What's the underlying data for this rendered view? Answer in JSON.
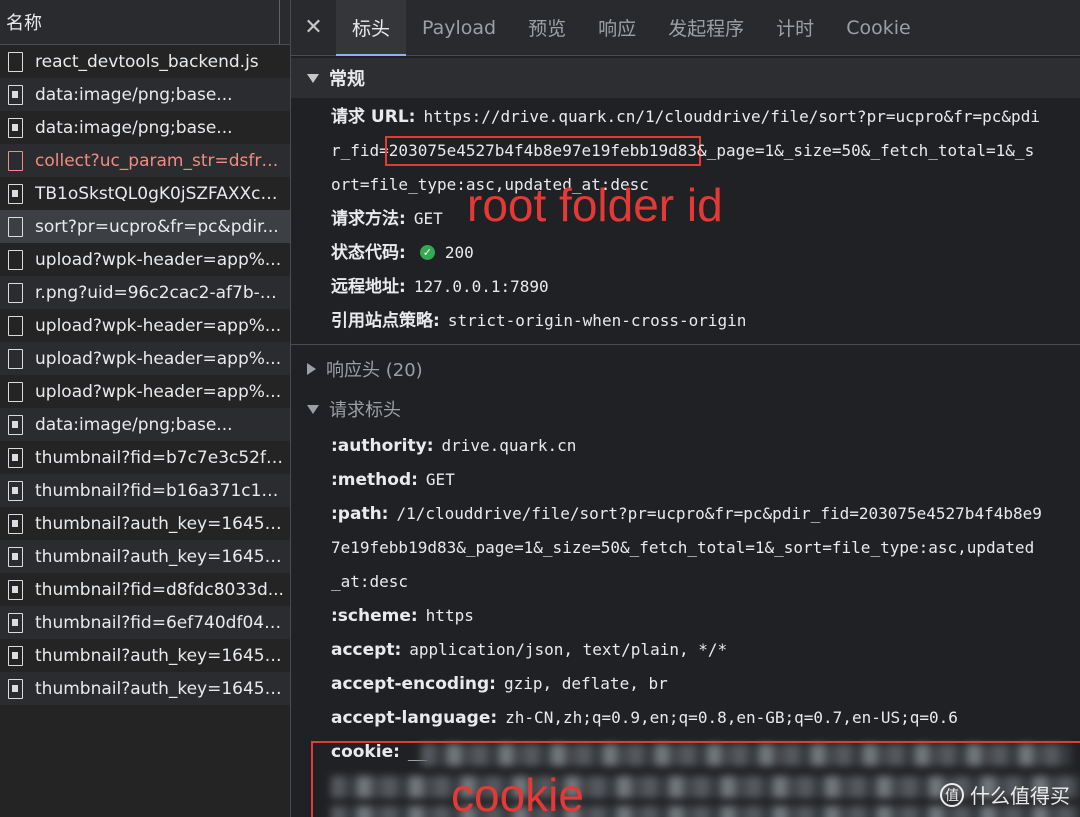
{
  "request_list": {
    "column_header": "名称",
    "items": [
      {
        "label": "react_devtools_backend.js",
        "type": "doc",
        "error": false,
        "selected": false
      },
      {
        "label": "data:image/png;base...",
        "type": "img",
        "error": false,
        "selected": false
      },
      {
        "label": "data:image/png;base...",
        "type": "img",
        "error": false,
        "selected": false
      },
      {
        "label": "collect?uc_param_str=dsfrpf...",
        "type": "doc",
        "error": true,
        "selected": false
      },
      {
        "label": "TB1oSkstQL0gK0jSZFAXXcA...",
        "type": "img",
        "error": false,
        "selected": false
      },
      {
        "label": "sort?pr=ucpro&fr=pc&pdir...",
        "type": "doc",
        "error": false,
        "selected": true
      },
      {
        "label": "upload?wpk-header=app%...",
        "type": "doc",
        "error": false,
        "selected": false
      },
      {
        "label": "r.png?uid=96c2cac2-af7b-4...",
        "type": "doc",
        "error": false,
        "selected": false
      },
      {
        "label": "upload?wpk-header=app%...",
        "type": "doc",
        "error": false,
        "selected": false
      },
      {
        "label": "upload?wpk-header=app%...",
        "type": "doc",
        "error": false,
        "selected": false
      },
      {
        "label": "upload?wpk-header=app%...",
        "type": "doc",
        "error": false,
        "selected": false
      },
      {
        "label": "data:image/png;base...",
        "type": "img",
        "error": false,
        "selected": false
      },
      {
        "label": "thumbnail?fid=b7c7e3c52f6...",
        "type": "img",
        "error": false,
        "selected": false
      },
      {
        "label": "thumbnail?fid=b16a371c10...",
        "type": "img",
        "error": false,
        "selected": false
      },
      {
        "label": "thumbnail?auth_key=16451...",
        "type": "img",
        "error": false,
        "selected": false
      },
      {
        "label": "thumbnail?auth_key=16451...",
        "type": "img",
        "error": false,
        "selected": false
      },
      {
        "label": "thumbnail?fid=d8fdc8033d...",
        "type": "img",
        "error": false,
        "selected": false
      },
      {
        "label": "thumbnail?fid=6ef740df04ff...",
        "type": "img",
        "error": false,
        "selected": false
      },
      {
        "label": "thumbnail?auth_key=16451...",
        "type": "img",
        "error": false,
        "selected": false
      },
      {
        "label": "thumbnail?auth_key=16451...",
        "type": "img",
        "error": false,
        "selected": false
      }
    ]
  },
  "tabs": {
    "close": "✕",
    "items": [
      "标头",
      "Payload",
      "预览",
      "响应",
      "发起程序",
      "计时",
      "Cookie"
    ],
    "active_index": 0
  },
  "general": {
    "title": "常规",
    "request_url_key": "请求 URL:",
    "request_url_line1": "https://drive.quark.cn/1/clouddrive/file/sort?pr=ucpro&fr=pc&pdi",
    "request_url_line2_prefix": "r_fid=",
    "request_url_line2_highlight": "203075e4527b4f4b8e97e19febb19d83",
    "request_url_line2_suffix": "&_page=1&_size=50&_fetch_total=1&_s",
    "request_url_line3": "ort=file_type:asc,updated_at:desc",
    "method_key": "请求方法:",
    "method_value": "GET",
    "status_key": "状态代码:",
    "status_value": "200",
    "remote_key": "远程地址:",
    "remote_value": "127.0.0.1:7890",
    "referrer_key": "引用站点策略:",
    "referrer_value": "strict-origin-when-cross-origin"
  },
  "response_headers": {
    "title": "响应头 (20)"
  },
  "request_headers": {
    "title": "请求标头",
    "authority_key": ":authority:",
    "authority_value": "drive.quark.cn",
    "method_key": ":method:",
    "method_value": "GET",
    "path_key": ":path:",
    "path_line1": "/1/clouddrive/file/sort?pr=ucpro&fr=pc&pdir_fid=203075e4527b4f4b8e9",
    "path_line2": "7e19febb19d83&_page=1&_size=50&_fetch_total=1&_sort=file_type:asc,updated",
    "path_line3": "_at:desc",
    "scheme_key": ":scheme:",
    "scheme_value": "https",
    "accept_key": "accept:",
    "accept_value": "application/json, text/plain, */*",
    "encoding_key": "accept-encoding:",
    "encoding_value": "gzip, deflate, br",
    "language_key": "accept-language:",
    "language_value": "zh-CN,zh;q=0.9,en;q=0.8,en-GB;q=0.7,en-US;q=0.6",
    "cookie_key": "cookie:",
    "cookie_value": "__"
  },
  "annotations": {
    "root_folder": "root folder id",
    "cookie": "cookie"
  },
  "watermark": {
    "logo": "值",
    "text": "什么值得买"
  },
  "colors": {
    "annotation_red": "#e53935",
    "status_green": "#34a853",
    "error_text": "#f28b82"
  }
}
